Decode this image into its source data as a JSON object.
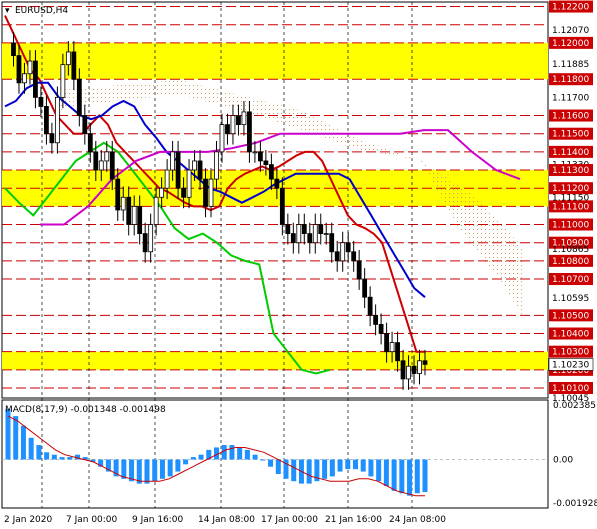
{
  "window": {
    "title": "EURUSD,H4",
    "macd_label": "MACD(8,17,9) -0.001348 -0.001498"
  },
  "chart_data": [
    {
      "type": "candlestick",
      "symbol": "EURUSD",
      "timeframe": "H4",
      "ylim": [
        1.10045,
        1.12225
      ],
      "price_axis_labels": [
        "1.12200",
        "1.12070",
        "1.12000",
        "1.11885",
        "1.11800",
        "1.11700",
        "1.11600",
        "1.11500",
        "1.11400",
        "1.11330",
        "1.11300",
        "1.11200",
        "1.11150",
        "1.11100",
        "1.11000",
        "1.10900",
        "1.10865",
        "1.10800",
        "1.10700",
        "1.10595",
        "1.10500",
        "1.10400",
        "1.10300",
        "1.10230",
        "1.10200",
        "1.10100",
        "1.10045"
      ],
      "current_price": "1.10230",
      "x_labels": [
        "2 Jan 2020",
        "7 Jan 00:00",
        "9 Jan 16:00",
        "14 Jan 08:00",
        "17 Jan 00:00",
        "21 Jan 16:00",
        "24 Jan 08:00"
      ],
      "support_resistance_levels": [
        1.122,
        1.121,
        1.12,
        1.118,
        1.116,
        1.115,
        1.114,
        1.113,
        1.112,
        1.111,
        1.11,
        1.109,
        1.108,
        1.107,
        1.105,
        1.104,
        1.103,
        1.102,
        1.101
      ],
      "highlight_zones": [
        [
          1.118,
          1.12
        ],
        [
          1.111,
          1.113
        ],
        [
          1.102,
          1.103
        ]
      ],
      "close_series": [
        1.12,
        1.1193,
        1.1178,
        1.1183,
        1.119,
        1.117,
        1.1165,
        1.115,
        1.1145,
        1.117,
        1.1188,
        1.1195,
        1.118,
        1.116,
        1.115,
        1.114,
        1.113,
        1.1135,
        1.114,
        1.1125,
        1.1108,
        1.1115,
        1.11,
        1.111,
        1.1095,
        1.1085,
        1.11,
        1.1115,
        1.112,
        1.113,
        1.114,
        1.112,
        1.1115,
        1.113,
        1.1135,
        1.1125,
        1.111,
        1.1125,
        1.114,
        1.1155,
        1.115,
        1.116,
        1.1155,
        1.1162,
        1.114,
        1.114,
        1.1135,
        1.1133,
        1.1125,
        1.112,
        1.11,
        1.1095,
        1.109,
        1.11,
        1.1095,
        1.109,
        1.11,
        1.1095,
        1.1095,
        1.1085,
        1.108,
        1.109,
        1.1085,
        1.108,
        1.107,
        1.106,
        1.105,
        1.1045,
        1.104,
        1.103,
        1.1035,
        1.1025,
        1.1015,
        1.1022,
        1.1018,
        1.1025,
        1.1023
      ],
      "moving_averages": [
        {
          "color": "#cc0000",
          "values": [
            1.1215,
            1.1205,
            1.1195,
            1.1185,
            1.118,
            1.117,
            1.116,
            1.1155,
            1.115,
            1.115,
            1.1155,
            1.116,
            1.1155,
            1.1145,
            1.114,
            1.1135,
            1.113,
            1.1125,
            1.112,
            1.1118,
            1.1115,
            1.1112,
            1.111,
            1.111,
            1.1108,
            1.111,
            1.112,
            1.1125,
            1.1128,
            1.113,
            1.1132,
            1.113,
            1.1132,
            1.1135,
            1.1138,
            1.114,
            1.114,
            1.1135,
            1.1125,
            1.1115,
            1.1105,
            1.11,
            1.1098,
            1.1095,
            1.109,
            1.1075,
            1.106,
            1.1045,
            1.103,
            1.103
          ]
        },
        {
          "color": "#0000cc",
          "values": [
            1.1165,
            1.1168,
            1.1175,
            1.1178,
            1.1178,
            1.117,
            1.1165,
            1.116,
            1.1158,
            1.116,
            1.1165,
            1.1168,
            1.1165,
            1.1155,
            1.1148,
            1.114,
            1.1135,
            1.113,
            1.1125,
            1.112,
            1.1118,
            1.1115,
            1.1112,
            1.1115,
            1.1118,
            1.1122,
            1.1125,
            1.1128,
            1.1128,
            1.1128,
            1.1128,
            1.1128,
            1.1125,
            1.1115,
            1.1105,
            1.1095,
            1.1085,
            1.1075,
            1.1065,
            1.106
          ]
        },
        {
          "color": "#00cc00",
          "values": [
            1.112,
            1.1112,
            1.1105,
            1.1115,
            1.1125,
            1.1135,
            1.114,
            1.1145,
            1.114,
            1.113,
            1.112,
            1.111,
            1.1098,
            1.1092,
            1.1095,
            1.109,
            1.1083,
            1.108,
            1.1078,
            1.104,
            1.103,
            1.102,
            1.1018,
            1.102
          ]
        },
        {
          "color": "#cc00cc",
          "values": [
            1.11,
            1.11,
            1.111,
            1.1125,
            1.1135,
            1.114,
            1.114,
            1.114,
            1.1142,
            1.1145,
            1.115,
            1.115,
            1.115,
            1.115,
            1.115,
            1.115,
            1.1152,
            1.1152,
            1.114,
            1.113,
            1.1125
          ]
        }
      ]
    },
    {
      "type": "bar",
      "name": "MACD(8,17,9)",
      "yaxis_labels": [
        "0.002385",
        "0.00",
        "-0.001928"
      ],
      "ylim": [
        -0.001928,
        0.002385
      ],
      "values": [
        0.0021,
        0.0018,
        0.0014,
        0.0009,
        0.0006,
        0.0003,
        0.0002,
        0.0001,
        0.0001,
        0.0002,
        0.0001,
        -0.0001,
        -0.0003,
        -0.0005,
        -0.0007,
        -0.0008,
        -0.0009,
        -0.001,
        -0.001,
        -0.0009,
        -0.0008,
        -0.0007,
        -0.0005,
        -0.0002,
        0.0001,
        0.0002,
        0.0004,
        0.0005,
        0.0006,
        0.0006,
        0.0005,
        0.0004,
        0.0002,
        0.0,
        -0.0003,
        -0.0006,
        -0.0008,
        -0.0009,
        -0.001,
        -0.001,
        -0.0009,
        -0.0008,
        -0.0007,
        -0.0005,
        -0.0004,
        -0.0004,
        -0.0005,
        -0.0007,
        -0.0009,
        -0.0011,
        -0.0013,
        -0.0014,
        -0.0015,
        -0.0014,
        -0.00135
      ],
      "signal": [
        0.0018,
        0.0016,
        0.0013,
        0.001,
        0.0007,
        0.0004,
        0.0002,
        0.0001,
        0.0,
        -0.0001,
        -0.0003,
        -0.0005,
        -0.0007,
        -0.0008,
        -0.0009,
        -0.0009,
        -0.0009,
        -0.0008,
        -0.0006,
        -0.0004,
        -0.0002,
        0.0,
        0.0002,
        0.0004,
        0.0005,
        0.0005,
        0.0004,
        0.0003,
        0.0001,
        -0.0001,
        -0.0003,
        -0.0005,
        -0.0007,
        -0.0008,
        -0.0009,
        -0.0009,
        -0.0009,
        -0.0008,
        -0.0008,
        -0.0009,
        -0.0011,
        -0.0013,
        -0.0014,
        -0.0015,
        -0.0015
      ]
    }
  ]
}
